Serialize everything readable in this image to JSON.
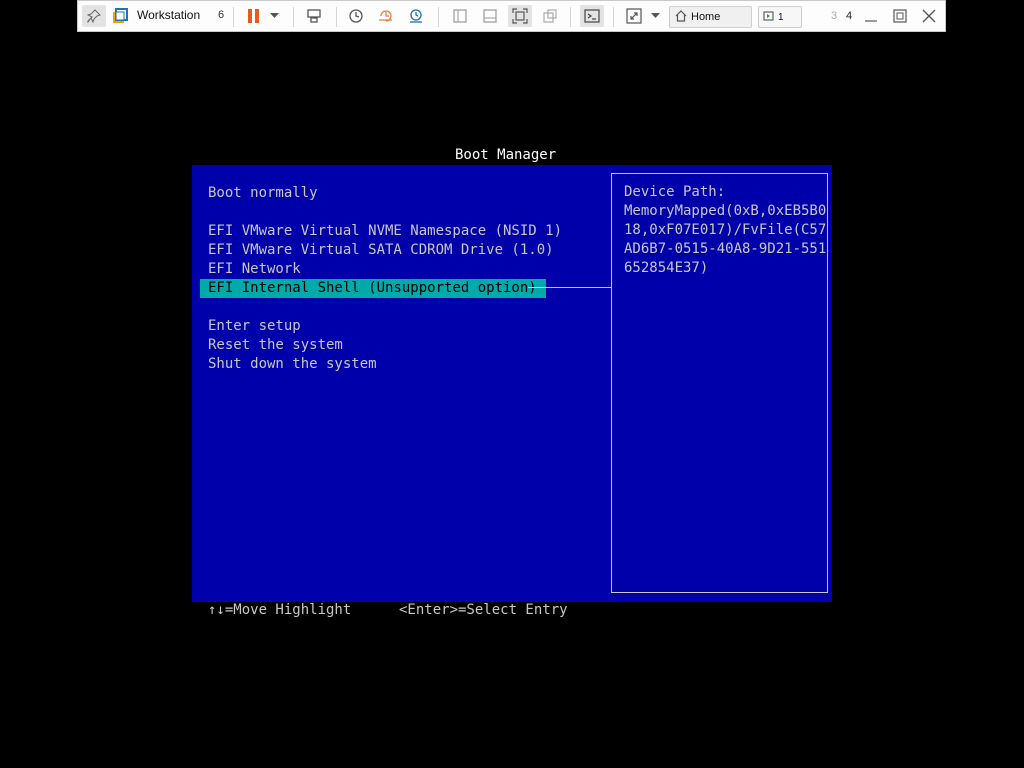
{
  "toolbar": {
    "app_name": "Workstation",
    "app_version": "6",
    "home_tab_label": "Home",
    "vm_tab_label": "1",
    "vm_count_dim": "3",
    "vm_count": "4",
    "icons": [
      "pin-icon",
      "vmware-logo-icon",
      "pause-icon",
      "dropdown-arrow-icon",
      "send-ctrl-alt-del-icon",
      "snapshot-icon",
      "revert-snapshot-icon",
      "snapshot-manager-icon",
      "library-view-icon",
      "thumbnail-view-icon",
      "full-screen-icon",
      "unity-icon",
      "console-icon",
      "stretch-guest-icon",
      "dropdown-arrow-icon",
      "home-icon",
      "vm-icon",
      "minimize-icon",
      "restore-icon",
      "close-icon"
    ]
  },
  "boot_manager": {
    "title": "Boot Manager",
    "menu": {
      "boot_normally": "Boot normally",
      "nvme": "EFI VMware Virtual NVME Namespace (NSID 1)",
      "sata_cdrom": "EFI VMware Virtual SATA CDROM Drive (1.0)",
      "network": "EFI Network",
      "internal_shell": "EFI Internal Shell (Unsupported option)",
      "enter_setup": "Enter setup",
      "reset": "Reset the system",
      "shutdown": "Shut down the system"
    },
    "selected_entry": "EFI Internal Shell (Unsupported option)",
    "device_path": {
      "label": "Device Path:",
      "lines": [
        "MemoryMapped(0xB,0xEB5B0",
        "18,0xF07E017)/FvFile(C57",
        "AD6B7-0515-40A8-9D21-551",
        "652854E37)"
      ]
    },
    "hints": {
      "move": "↑↓=Move Highlight",
      "select": "<Enter>=Select Entry"
    },
    "colors": {
      "background": "#0000aa",
      "highlight": "#00aaaa",
      "text": "#c8c8c8",
      "title": "#ffffff"
    }
  }
}
